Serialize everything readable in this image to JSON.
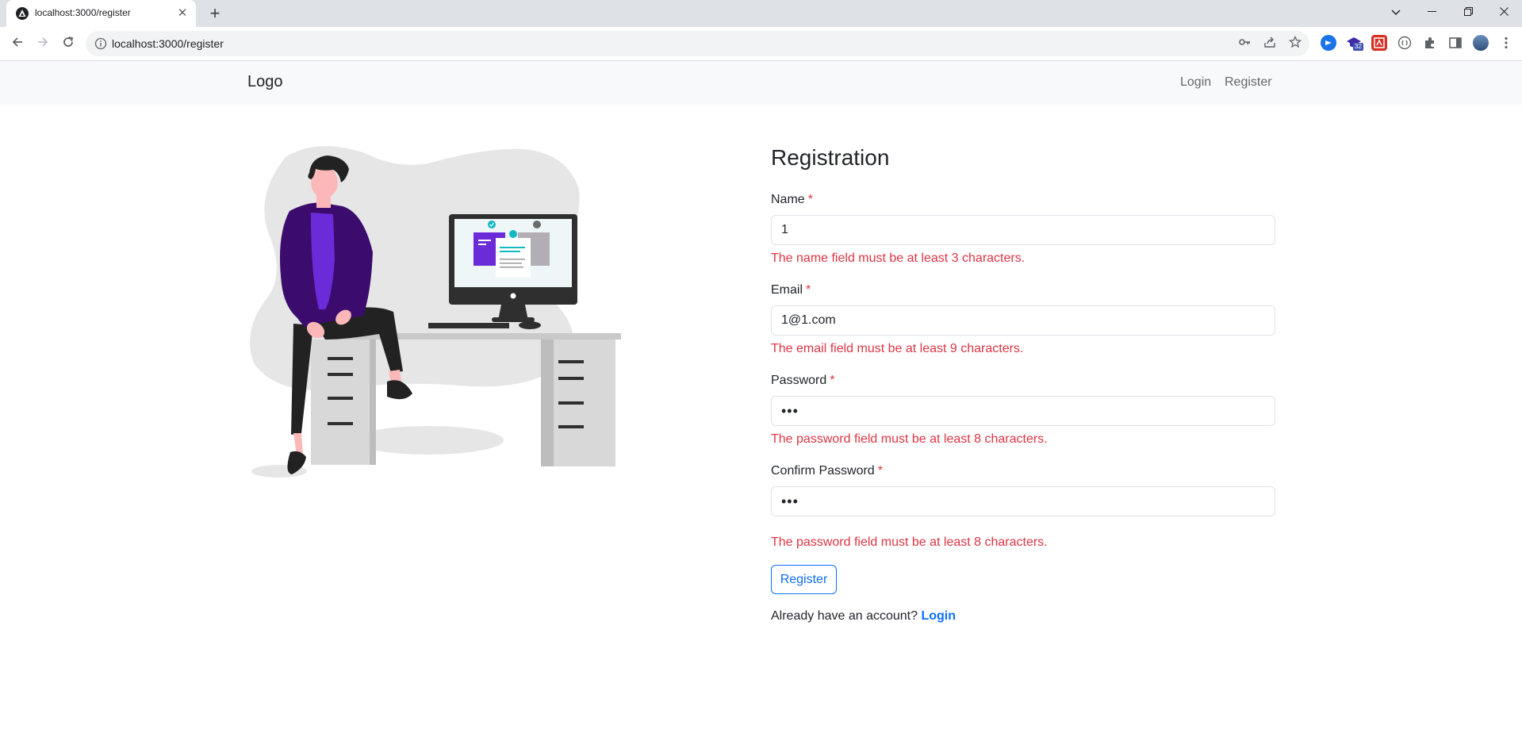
{
  "browser": {
    "tab_title": "localhost:3000/register",
    "url": "localhost:3000/register",
    "icons": [
      "back-arrow-icon",
      "forward-arrow-icon",
      "reload-icon",
      "site-info-icon",
      "key-icon",
      "share-icon",
      "star-icon",
      "puzzle-icon",
      "sidepanel-icon",
      "profile-avatar",
      "menu-dots-icon"
    ],
    "extension_badge": "32"
  },
  "navbar": {
    "brand": "Logo",
    "links": [
      "Login",
      "Register"
    ]
  },
  "form": {
    "title": "Registration",
    "required_mark": "*",
    "fields": [
      {
        "label": "Name",
        "value": "1",
        "error": "The name field must be at least 3 characters."
      },
      {
        "label": "Email",
        "value": "1@1.com",
        "error": "The email field must be at least 9 characters."
      },
      {
        "label": "Password",
        "value": "•••",
        "error": "The password field must be at least 8 characters."
      },
      {
        "label": "Confirm Password",
        "value": "•••",
        "error": "The password field must be at least 8 characters."
      }
    ],
    "submit_label": "Register",
    "footer_text": "Already have an account?",
    "footer_link": "Login"
  },
  "colors": {
    "primary": "#0d6efd",
    "danger": "#dc3545",
    "navbar_bg": "#f8f9fa",
    "illustration_accent": "#6c2bd9"
  }
}
